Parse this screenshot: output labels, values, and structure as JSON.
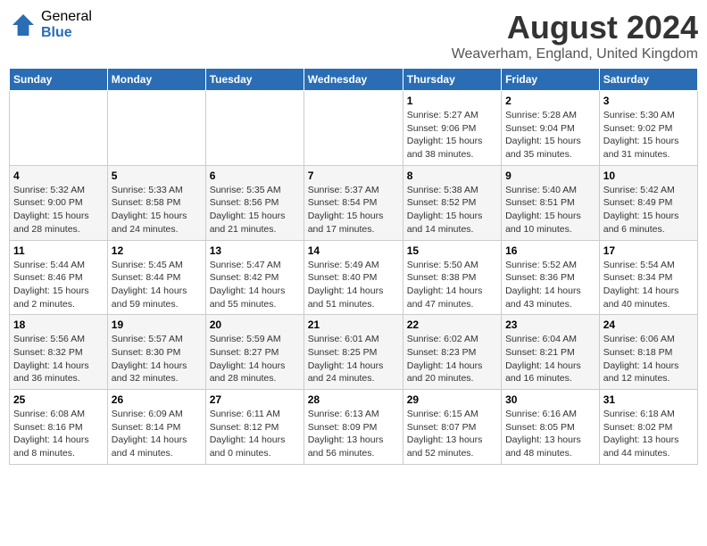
{
  "logo": {
    "general": "General",
    "blue": "Blue"
  },
  "title": "August 2024",
  "subtitle": "Weaverham, England, United Kingdom",
  "headers": [
    "Sunday",
    "Monday",
    "Tuesday",
    "Wednesday",
    "Thursday",
    "Friday",
    "Saturday"
  ],
  "weeks": [
    [
      {
        "day": "",
        "info": ""
      },
      {
        "day": "",
        "info": ""
      },
      {
        "day": "",
        "info": ""
      },
      {
        "day": "",
        "info": ""
      },
      {
        "day": "1",
        "info": "Sunrise: 5:27 AM\nSunset: 9:06 PM\nDaylight: 15 hours\nand 38 minutes."
      },
      {
        "day": "2",
        "info": "Sunrise: 5:28 AM\nSunset: 9:04 PM\nDaylight: 15 hours\nand 35 minutes."
      },
      {
        "day": "3",
        "info": "Sunrise: 5:30 AM\nSunset: 9:02 PM\nDaylight: 15 hours\nand 31 minutes."
      }
    ],
    [
      {
        "day": "4",
        "info": "Sunrise: 5:32 AM\nSunset: 9:00 PM\nDaylight: 15 hours\nand 28 minutes."
      },
      {
        "day": "5",
        "info": "Sunrise: 5:33 AM\nSunset: 8:58 PM\nDaylight: 15 hours\nand 24 minutes."
      },
      {
        "day": "6",
        "info": "Sunrise: 5:35 AM\nSunset: 8:56 PM\nDaylight: 15 hours\nand 21 minutes."
      },
      {
        "day": "7",
        "info": "Sunrise: 5:37 AM\nSunset: 8:54 PM\nDaylight: 15 hours\nand 17 minutes."
      },
      {
        "day": "8",
        "info": "Sunrise: 5:38 AM\nSunset: 8:52 PM\nDaylight: 15 hours\nand 14 minutes."
      },
      {
        "day": "9",
        "info": "Sunrise: 5:40 AM\nSunset: 8:51 PM\nDaylight: 15 hours\nand 10 minutes."
      },
      {
        "day": "10",
        "info": "Sunrise: 5:42 AM\nSunset: 8:49 PM\nDaylight: 15 hours\nand 6 minutes."
      }
    ],
    [
      {
        "day": "11",
        "info": "Sunrise: 5:44 AM\nSunset: 8:46 PM\nDaylight: 15 hours\nand 2 minutes."
      },
      {
        "day": "12",
        "info": "Sunrise: 5:45 AM\nSunset: 8:44 PM\nDaylight: 14 hours\nand 59 minutes."
      },
      {
        "day": "13",
        "info": "Sunrise: 5:47 AM\nSunset: 8:42 PM\nDaylight: 14 hours\nand 55 minutes."
      },
      {
        "day": "14",
        "info": "Sunrise: 5:49 AM\nSunset: 8:40 PM\nDaylight: 14 hours\nand 51 minutes."
      },
      {
        "day": "15",
        "info": "Sunrise: 5:50 AM\nSunset: 8:38 PM\nDaylight: 14 hours\nand 47 minutes."
      },
      {
        "day": "16",
        "info": "Sunrise: 5:52 AM\nSunset: 8:36 PM\nDaylight: 14 hours\nand 43 minutes."
      },
      {
        "day": "17",
        "info": "Sunrise: 5:54 AM\nSunset: 8:34 PM\nDaylight: 14 hours\nand 40 minutes."
      }
    ],
    [
      {
        "day": "18",
        "info": "Sunrise: 5:56 AM\nSunset: 8:32 PM\nDaylight: 14 hours\nand 36 minutes."
      },
      {
        "day": "19",
        "info": "Sunrise: 5:57 AM\nSunset: 8:30 PM\nDaylight: 14 hours\nand 32 minutes."
      },
      {
        "day": "20",
        "info": "Sunrise: 5:59 AM\nSunset: 8:27 PM\nDaylight: 14 hours\nand 28 minutes."
      },
      {
        "day": "21",
        "info": "Sunrise: 6:01 AM\nSunset: 8:25 PM\nDaylight: 14 hours\nand 24 minutes."
      },
      {
        "day": "22",
        "info": "Sunrise: 6:02 AM\nSunset: 8:23 PM\nDaylight: 14 hours\nand 20 minutes."
      },
      {
        "day": "23",
        "info": "Sunrise: 6:04 AM\nSunset: 8:21 PM\nDaylight: 14 hours\nand 16 minutes."
      },
      {
        "day": "24",
        "info": "Sunrise: 6:06 AM\nSunset: 8:18 PM\nDaylight: 14 hours\nand 12 minutes."
      }
    ],
    [
      {
        "day": "25",
        "info": "Sunrise: 6:08 AM\nSunset: 8:16 PM\nDaylight: 14 hours\nand 8 minutes."
      },
      {
        "day": "26",
        "info": "Sunrise: 6:09 AM\nSunset: 8:14 PM\nDaylight: 14 hours\nand 4 minutes."
      },
      {
        "day": "27",
        "info": "Sunrise: 6:11 AM\nSunset: 8:12 PM\nDaylight: 14 hours\nand 0 minutes."
      },
      {
        "day": "28",
        "info": "Sunrise: 6:13 AM\nSunset: 8:09 PM\nDaylight: 13 hours\nand 56 minutes."
      },
      {
        "day": "29",
        "info": "Sunrise: 6:15 AM\nSunset: 8:07 PM\nDaylight: 13 hours\nand 52 minutes."
      },
      {
        "day": "30",
        "info": "Sunrise: 6:16 AM\nSunset: 8:05 PM\nDaylight: 13 hours\nand 48 minutes."
      },
      {
        "day": "31",
        "info": "Sunrise: 6:18 AM\nSunset: 8:02 PM\nDaylight: 13 hours\nand 44 minutes."
      }
    ]
  ]
}
